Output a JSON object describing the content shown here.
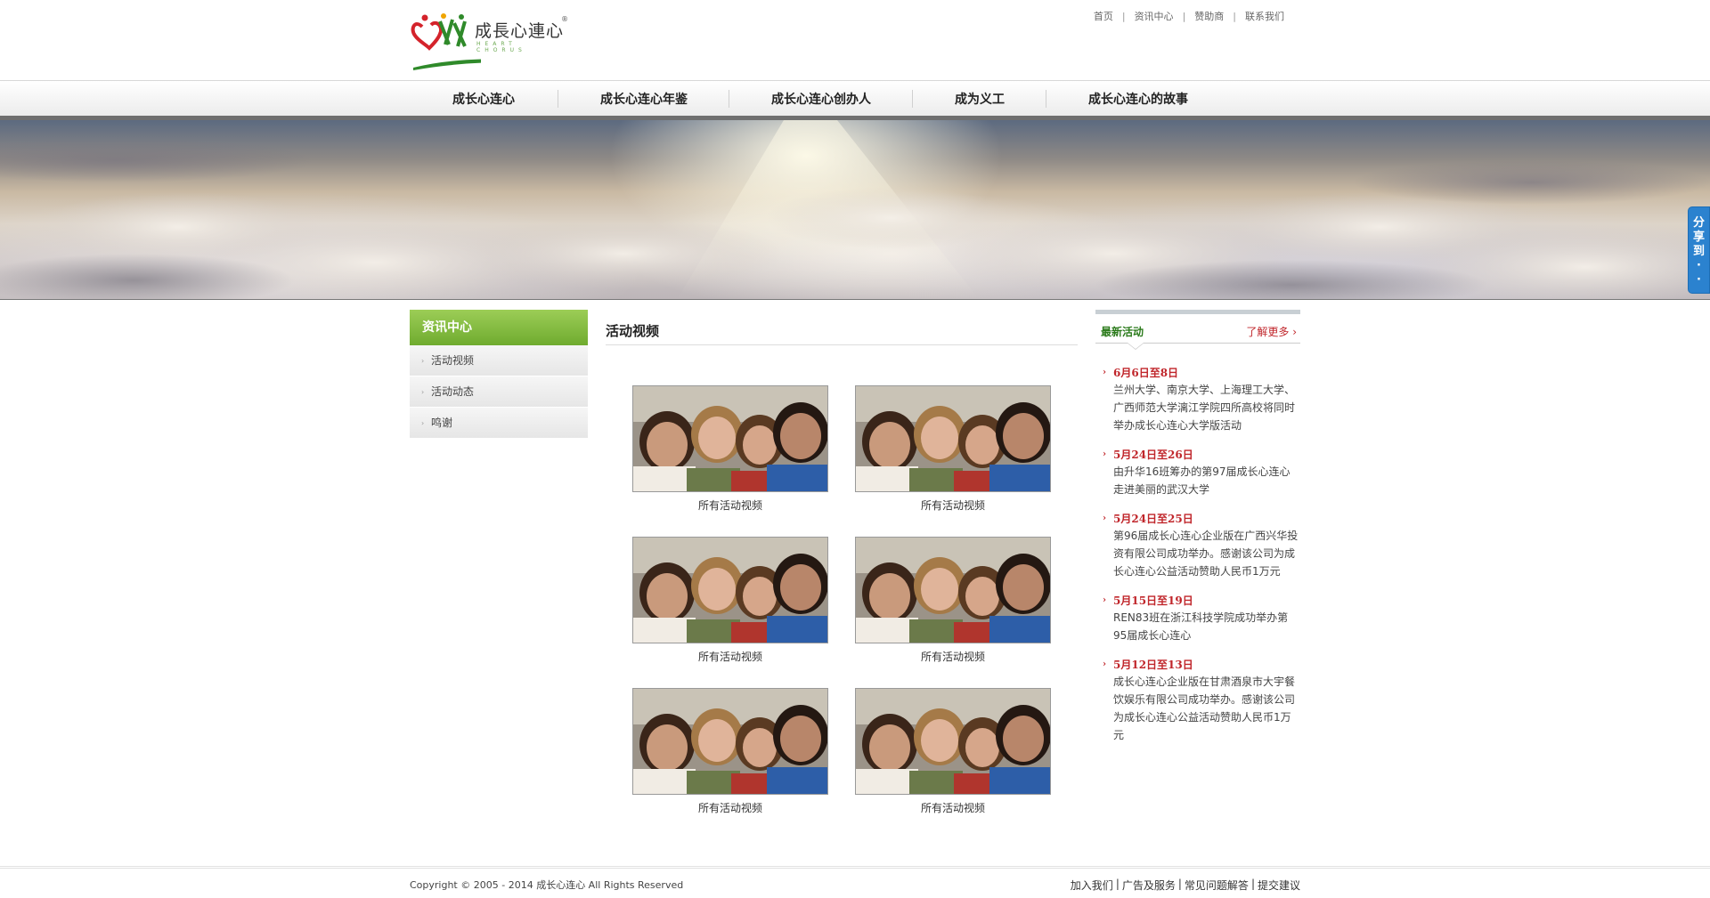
{
  "header": {
    "logo_text": "成長心連心",
    "logo_sub": "HEART CHORUS",
    "logo_reg": "®",
    "top_links": [
      "首页",
      "资讯中心",
      "赞助商",
      "联系我们"
    ],
    "top_sep": "|"
  },
  "nav": {
    "items": [
      "成长心连心",
      "成长心连心年鉴",
      "成长心连心创办人",
      "成为义工",
      "成长心连心的故事"
    ]
  },
  "share": {
    "label_chars": [
      "分",
      "享",
      "到",
      "·",
      "·"
    ]
  },
  "sidebar": {
    "title": "资讯中心",
    "items": [
      "活动视频",
      "活动动态",
      "鸣谢"
    ],
    "bullet": "›"
  },
  "main": {
    "title": "活动视频",
    "videos": [
      {
        "caption": "所有活动视频"
      },
      {
        "caption": "所有活动视频"
      },
      {
        "caption": "所有活动视频"
      },
      {
        "caption": "所有活动视频"
      },
      {
        "caption": "所有活动视频"
      },
      {
        "caption": "所有活动视频"
      }
    ]
  },
  "right": {
    "title": "最新活动",
    "more": "了解更多",
    "more_arrow": "›",
    "chev": "›",
    "news": [
      {
        "date": "6月6日至8日",
        "text": "兰州大学、南京大学、上海理工大学、广西师范大学漓江学院四所高校将同时举办成长心连心大学版活动"
      },
      {
        "date": "5月24日至26日",
        "text": "由升华16班筹办的第97届成长心连心走进美丽的武汉大学"
      },
      {
        "date": "5月24日至25日",
        "text": "第96届成长心连心企业版在广西兴华投资有限公司成功举办。感谢该公司为成长心连心公益活动赞助人民币1万元"
      },
      {
        "date": "5月15日至19日",
        "text": "REN83班在浙江科技学院成功举办第95届成长心连心"
      },
      {
        "date": "5月12日至13日",
        "text": "成长心连心企业版在甘肃酒泉市大宇餐饮娱乐有限公司成功举办。感谢该公司为成长心连心公益活动赞助人民币1万元"
      }
    ]
  },
  "footer": {
    "copyright": "Copyright © 2005 - 2014 成长心连心 All Rights Reserved",
    "links": [
      "加入我们",
      "广告及服务",
      "常见问题解答",
      "提交建议"
    ],
    "sep": "|"
  },
  "colors": {
    "accent_green": "#6fab2f",
    "accent_red": "#c0262b",
    "share_blue": "#2b82cf"
  }
}
